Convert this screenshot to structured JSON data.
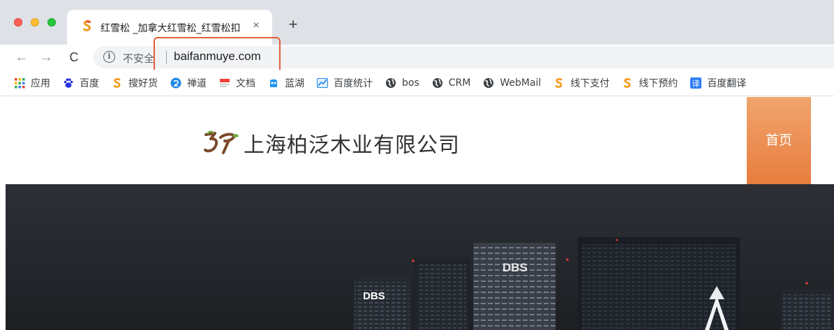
{
  "browser": {
    "tab": {
      "title": "红雪松 _加拿大红雪松_红雪松扣",
      "close_glyph": "×",
      "favicon": "dollar-s-icon"
    },
    "new_tab_glyph": "+",
    "nav": {
      "back_glyph": "←",
      "forward_glyph": "→",
      "reload_glyph": "C"
    },
    "omnibox": {
      "info_glyph": "i",
      "security_label": "不安全",
      "url": "baifanmuye.com"
    },
    "bookmarks": [
      {
        "label": "应用",
        "icon": "apps-grid-icon",
        "color": "#1a73e8"
      },
      {
        "label": "百度",
        "icon": "baidu-paw-icon",
        "color": "#2932e1"
      },
      {
        "label": "搜好货",
        "icon": "dollar-s-icon",
        "color": "#f29b20"
      },
      {
        "label": "禅道",
        "icon": "zentao-icon",
        "color": "#1e88e5"
      },
      {
        "label": "文档",
        "icon": "doc-icon",
        "color": "#f44336"
      },
      {
        "label": "蓝湖",
        "icon": "lanhu-icon",
        "color": "#2196f3"
      },
      {
        "label": "百度统计",
        "icon": "chart-icon",
        "color": "#1e88e5"
      },
      {
        "label": "bos",
        "icon": "globe-icon",
        "color": "#3c4043"
      },
      {
        "label": "CRM",
        "icon": "globe-icon",
        "color": "#3c4043"
      },
      {
        "label": "WebMail",
        "icon": "globe-icon",
        "color": "#3c4043"
      },
      {
        "label": "线下支付",
        "icon": "dollar-s-icon",
        "color": "#f29b20"
      },
      {
        "label": "线下预约",
        "icon": "dollar-s-icon",
        "color": "#f29b20"
      },
      {
        "label": "百度翻译",
        "icon": "translate-icon",
        "color": "#2f7cf6"
      }
    ]
  },
  "site": {
    "company_name": "上海柏泛木业有限公司",
    "nav_home": "首页",
    "accent_color": "#e87d3e",
    "banner_signs": [
      "DBS",
      "DBS"
    ]
  }
}
